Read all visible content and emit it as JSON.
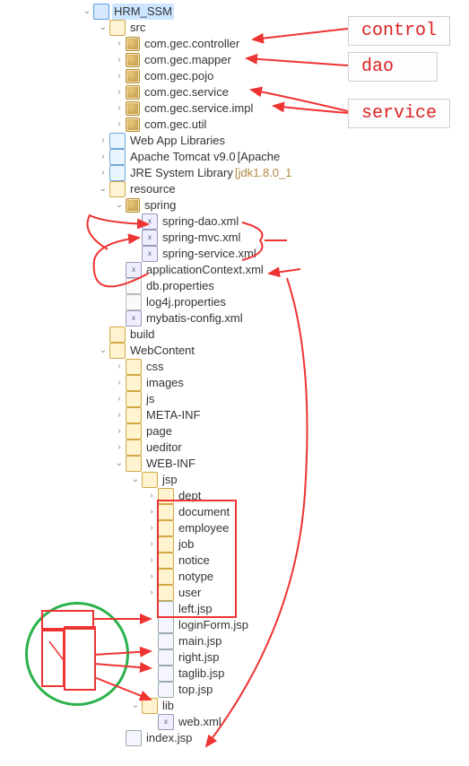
{
  "project": "HRM_SSM",
  "jdk_label": "[jdk1.8.0_1",
  "tomcat_suffix": "[Apache",
  "annotations": {
    "control": "control",
    "dao": "dao",
    "service": "service"
  },
  "nodes": [
    {
      "depth": 0,
      "tw": "v",
      "icon": "project",
      "label": "HRM_SSM",
      "sel": true
    },
    {
      "depth": 1,
      "tw": "v",
      "icon": "src",
      "label": "src"
    },
    {
      "depth": 2,
      "tw": ">",
      "icon": "package",
      "label": "com.gec.controller"
    },
    {
      "depth": 2,
      "tw": ">",
      "icon": "package",
      "label": "com.gec.mapper"
    },
    {
      "depth": 2,
      "tw": ">",
      "icon": "package",
      "label": "com.gec.pojo"
    },
    {
      "depth": 2,
      "tw": ">",
      "icon": "package",
      "label": "com.gec.service"
    },
    {
      "depth": 2,
      "tw": ">",
      "icon": "package",
      "label": "com.gec.service.impl"
    },
    {
      "depth": 2,
      "tw": ">",
      "icon": "package",
      "label": "com.gec.util"
    },
    {
      "depth": 1,
      "tw": ">",
      "icon": "lib",
      "label": "Web App Libraries"
    },
    {
      "depth": 1,
      "tw": ">",
      "icon": "lib",
      "label": "Apache Tomcat v9.0 ",
      "extra": "tomcat"
    },
    {
      "depth": 1,
      "tw": ">",
      "icon": "lib",
      "label": "JRE System Library ",
      "extra": "jdk"
    },
    {
      "depth": 1,
      "tw": "v",
      "icon": "src",
      "label": "resource"
    },
    {
      "depth": 2,
      "tw": "v",
      "icon": "package",
      "label": "spring"
    },
    {
      "depth": 3,
      "tw": "",
      "icon": "xml",
      "label": "spring-dao.xml"
    },
    {
      "depth": 3,
      "tw": "",
      "icon": "xml",
      "label": "spring-mvc.xml"
    },
    {
      "depth": 3,
      "tw": "",
      "icon": "xml",
      "label": "spring-service.xml"
    },
    {
      "depth": 2,
      "tw": "",
      "icon": "xml",
      "label": "applicationContext.xml"
    },
    {
      "depth": 2,
      "tw": "",
      "icon": "file",
      "label": "db.properties"
    },
    {
      "depth": 2,
      "tw": "",
      "icon": "file",
      "label": "log4j.properties"
    },
    {
      "depth": 2,
      "tw": "",
      "icon": "xml",
      "label": "mybatis-config.xml"
    },
    {
      "depth": 1,
      "tw": "",
      "icon": "folder",
      "label": "build"
    },
    {
      "depth": 1,
      "tw": "v",
      "icon": "folder-open",
      "label": "WebContent"
    },
    {
      "depth": 2,
      "tw": ">",
      "icon": "folder",
      "label": "css"
    },
    {
      "depth": 2,
      "tw": ">",
      "icon": "folder",
      "label": "images"
    },
    {
      "depth": 2,
      "tw": ">",
      "icon": "folder",
      "label": "js"
    },
    {
      "depth": 2,
      "tw": ">",
      "icon": "folder",
      "label": "META-INF"
    },
    {
      "depth": 2,
      "tw": ">",
      "icon": "folder",
      "label": "page"
    },
    {
      "depth": 2,
      "tw": ">",
      "icon": "folder",
      "label": "ueditor"
    },
    {
      "depth": 2,
      "tw": "v",
      "icon": "folder-open",
      "label": "WEB-INF"
    },
    {
      "depth": 3,
      "tw": "v",
      "icon": "folder-open",
      "label": "jsp"
    },
    {
      "depth": 4,
      "tw": ">",
      "icon": "folder",
      "label": "dept"
    },
    {
      "depth": 4,
      "tw": ">",
      "icon": "folder",
      "label": "document"
    },
    {
      "depth": 4,
      "tw": ">",
      "icon": "folder",
      "label": "employee"
    },
    {
      "depth": 4,
      "tw": ">",
      "icon": "folder",
      "label": "job"
    },
    {
      "depth": 4,
      "tw": ">",
      "icon": "folder",
      "label": "notice"
    },
    {
      "depth": 4,
      "tw": ">",
      "icon": "folder",
      "label": "notype"
    },
    {
      "depth": 4,
      "tw": ">",
      "icon": "folder",
      "label": "user"
    },
    {
      "depth": 4,
      "tw": "",
      "icon": "jsp",
      "label": "left.jsp"
    },
    {
      "depth": 4,
      "tw": "",
      "icon": "jsp",
      "label": "loginForm.jsp"
    },
    {
      "depth": 4,
      "tw": "",
      "icon": "jsp",
      "label": "main.jsp"
    },
    {
      "depth": 4,
      "tw": "",
      "icon": "jsp",
      "label": "right.jsp"
    },
    {
      "depth": 4,
      "tw": "",
      "icon": "jsp",
      "label": "taglib.jsp"
    },
    {
      "depth": 4,
      "tw": "",
      "icon": "jsp",
      "label": "top.jsp"
    },
    {
      "depth": 3,
      "tw": "v",
      "icon": "folder-open",
      "label": "lib"
    },
    {
      "depth": 4,
      "tw": "",
      "icon": "xml",
      "label": "web.xml"
    },
    {
      "depth": 2,
      "tw": "",
      "icon": "jsp",
      "label": "index.jsp"
    }
  ]
}
